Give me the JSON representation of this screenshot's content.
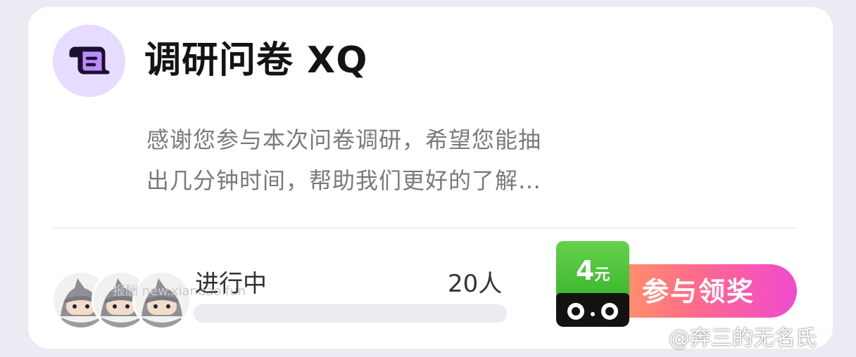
{
  "card": {
    "icon": "scroll-document-icon",
    "title": "调研问卷 XQ",
    "description_line1": "感谢您参与本次问卷调研，希望您能抽",
    "description_line2": "出几分钟时间，帮助我们更好的了解…",
    "status": "进行中",
    "participants": "20人",
    "progress_fraction": 0,
    "avatars": [
      "ninja-avatar",
      "ninja-avatar",
      "ninja-avatar"
    ],
    "avatar_watermark": "报酬 new.xianbao.fun"
  },
  "reward": {
    "amount": "4",
    "unit": "元",
    "icon": "tmall-cat-icon",
    "button_label": "参与领奖"
  },
  "weibo_watermark": "@奔三的无名氏",
  "colors": {
    "accent_purple": "#e7dcff",
    "badge_green": "#3bb52d",
    "cta_gradient_start": "#ffa35a",
    "cta_gradient_end": "#f04ad0"
  }
}
